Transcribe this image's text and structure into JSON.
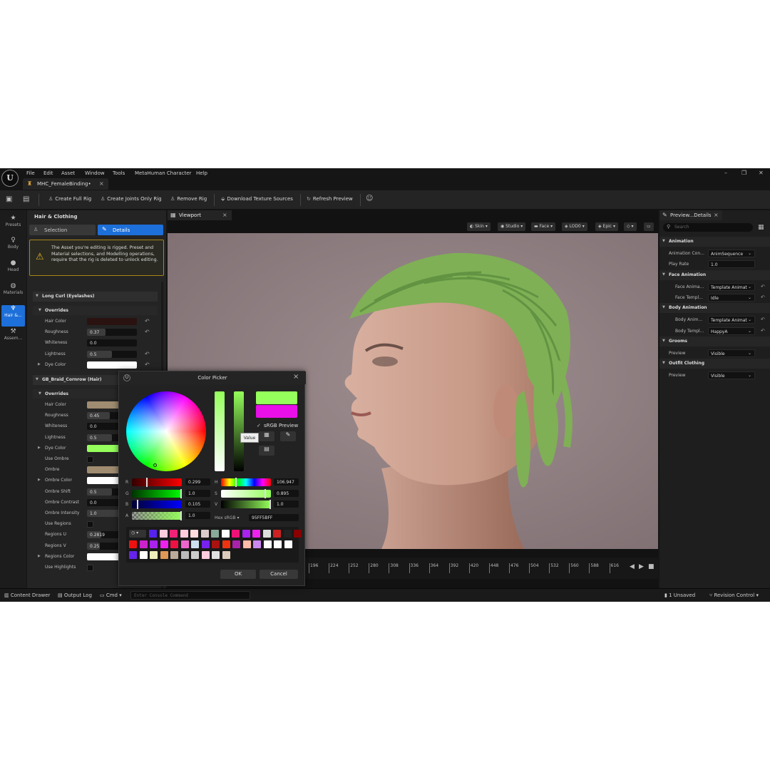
{
  "menubar": {
    "items": [
      "File",
      "Edit",
      "Asset",
      "Window",
      "Tools",
      "MetaHuman Character",
      "Help"
    ],
    "window_controls": [
      "–",
      "❐",
      "✕"
    ]
  },
  "doc_tab": {
    "label": "MHC_FemaleBinding•",
    "close": "×"
  },
  "toolbar": {
    "create_full_rig": "Create Full Rig",
    "create_joints_only_rig": "Create Joints Only Rig",
    "remove_rig": "Remove Rig",
    "download_texture_sources": "Download Texture Sources",
    "refresh_preview": "Refresh Preview"
  },
  "iconbar": {
    "items": [
      {
        "label": "Presets",
        "icon": "star-icon"
      },
      {
        "label": "Body",
        "icon": "body-icon"
      },
      {
        "label": "Head",
        "icon": "head-icon"
      },
      {
        "label": "Materials",
        "icon": "materials-icon"
      },
      {
        "label": "Hair &...",
        "icon": "hair-icon",
        "active": true
      },
      {
        "label": "Assem...",
        "icon": "hammer-icon"
      }
    ]
  },
  "left_panel": {
    "title": "Hair & Clothing",
    "tab_selection": "Selection",
    "tab_details": "Details",
    "warning": "The Asset you're editing is rigged. Preset and Material selections, and Modelling operations, require that the rig is deleted to unlock editing.",
    "section1": {
      "title": "Long Curl (Eyelashes)",
      "overrides": "Overrides",
      "rows": [
        {
          "label": "Hair Color",
          "kind": "swatch",
          "color": "#2a1210",
          "reset": true
        },
        {
          "label": "Roughness",
          "kind": "number",
          "value": "0.37",
          "fill": 0.37,
          "reset": true
        },
        {
          "label": "Whiteness",
          "kind": "number",
          "value": "0.0",
          "fill": 0.0,
          "reset": false
        },
        {
          "label": "Lightness",
          "kind": "number",
          "value": "0.5",
          "fill": 0.5,
          "reset": true
        },
        {
          "label": "Dye Color",
          "kind": "swatch",
          "color": "#ffffff",
          "reset": true,
          "expandable": true
        }
      ]
    },
    "section2": {
      "title": "GB_Braid_Cornrow (Hair)",
      "overrides": "Overrides",
      "rows": [
        {
          "label": "Hair Color",
          "kind": "swatch",
          "color": "#a08c70"
        },
        {
          "label": "Roughness",
          "kind": "number",
          "value": "0.45",
          "fill": 0.45
        },
        {
          "label": "Whiteness",
          "kind": "number",
          "value": "0.0",
          "fill": 0.0
        },
        {
          "label": "Lightness",
          "kind": "number",
          "value": "0.5",
          "fill": 0.5
        },
        {
          "label": "Dye Color",
          "kind": "swatch",
          "color": "#95ff5b",
          "expandable": true
        },
        {
          "label": "Use Ombre",
          "kind": "check"
        },
        {
          "label": "Ombre",
          "kind": "swatch",
          "color": "#a08c70"
        },
        {
          "label": "Ombre Color",
          "kind": "swatch",
          "color": "#ffffff",
          "expandable": true
        },
        {
          "label": "Ombre Shift",
          "kind": "number",
          "value": "0.5",
          "fill": 0.5
        },
        {
          "label": "Ombre Contrast",
          "kind": "number",
          "value": "0.0",
          "fill": 0.0
        },
        {
          "label": "Ombre Intensity",
          "kind": "number",
          "value": "1.0",
          "fill": 1.0
        },
        {
          "label": "Use Regions",
          "kind": "check"
        },
        {
          "label": "Regions U",
          "kind": "number",
          "value": "0.2819",
          "fill": 0.28
        },
        {
          "label": "Regions V",
          "kind": "number",
          "value": "0.25",
          "fill": 0.25
        },
        {
          "label": "Regions Color",
          "kind": "swatch",
          "color": "#ffffff",
          "expandable": true
        },
        {
          "label": "Use Highlights",
          "kind": "check"
        }
      ]
    }
  },
  "viewport": {
    "tab": "Viewport",
    "buttons": [
      "Skin",
      "Studio",
      "Face",
      "LOD0",
      "Epic"
    ],
    "timeline_ticks": [
      "196",
      "224",
      "252",
      "280",
      "308",
      "336",
      "364",
      "392",
      "420",
      "448",
      "476",
      "504",
      "532",
      "560",
      "588",
      "616"
    ]
  },
  "color_picker": {
    "title": "Color Picker",
    "new_color": "#95ff5b",
    "old_color": "#e80fe8",
    "srgb_preview": "sRGB Preview",
    "tooltip": "Value",
    "rgba": [
      {
        "label": "R",
        "value": "0.299",
        "marker": 0.299
      },
      {
        "label": "G",
        "value": "1.0",
        "marker": 1.0
      },
      {
        "label": "B",
        "value": "0.105",
        "marker": 0.105
      },
      {
        "label": "A",
        "value": "1.0",
        "marker": 1.0
      }
    ],
    "hsv": [
      {
        "label": "H",
        "value": "106.947",
        "marker": 0.297
      },
      {
        "label": "S",
        "value": "0.895",
        "marker": 0.895
      },
      {
        "label": "V",
        "value": "1.0",
        "marker": 1.0
      }
    ],
    "hex_label": "Hex sRGB",
    "hex_value": "95FF5BFF",
    "ok": "OK",
    "cancel": "Cancel",
    "swatches_row1": [
      "#5522ee",
      "#ffccdd",
      "#ee2277",
      "#ffccdd",
      "#ffdddd",
      "#ddcccc",
      "#88aa99",
      "#ffffff",
      "#ee1177",
      "#aa22ee",
      "#ee22ee",
      "#dddddd",
      "#cc2222",
      "#222222",
      "#880000"
    ],
    "swatches_row2": [
      "#ee1111",
      "#cc22cc",
      "#aa22ee",
      "#ee22ee",
      "#ee1144",
      "#ee66cc",
      "#cce0ee",
      "#7722ee",
      "#aa1111",
      "#ee3311",
      "#aa22aa",
      "#ffbbaa",
      "#cc88ee",
      "#ffffff",
      "#ffffff",
      "#ffffff"
    ],
    "swatches_row3": [
      "#6622ee",
      "#ffffff",
      "#eeeebb",
      "#dd9955",
      "#bbaa99",
      "#bbbbbb",
      "#cccccc",
      "#ffccdd",
      "#e0e0e0",
      "#ddccbb"
    ]
  },
  "right_panel": {
    "tab": "Preview...Details",
    "search_placeholder": "Search",
    "categories": [
      {
        "title": "Animation",
        "rows": [
          {
            "label": "Animation Con...",
            "value": "AnimSequence",
            "kind": "select"
          },
          {
            "label": "Play Rate",
            "value": "1.0",
            "kind": "number"
          }
        ]
      },
      {
        "title": "Face Animation",
        "rows": [
          {
            "label": "Face Anima...",
            "value": "Template Animat",
            "kind": "select",
            "reset": true
          },
          {
            "label": "Face Templ...",
            "value": "Idle",
            "kind": "select",
            "reset": true
          }
        ]
      },
      {
        "title": "Body Animation",
        "rows": [
          {
            "label": "Body Anim...",
            "value": "Template Animat",
            "kind": "select",
            "reset": true
          },
          {
            "label": "Body Templ...",
            "value": "HappyA",
            "kind": "select",
            "reset": true
          }
        ]
      },
      {
        "title": "Grooms",
        "rows": [
          {
            "label": "Preview",
            "value": "Visible",
            "kind": "select"
          }
        ]
      },
      {
        "title": "Outfit Clothing",
        "rows": [
          {
            "label": "Preview",
            "value": "Visible",
            "kind": "select"
          }
        ]
      }
    ]
  },
  "statusbar": {
    "content_drawer": "Content Drawer",
    "output_log": "Output Log",
    "cmd": "Cmd",
    "console_placeholder": "Enter Console Command",
    "unsaved": "1 Unsaved",
    "revision_control": "Revision Control"
  },
  "colors": {
    "accent": "#1d6fd9",
    "hair_dye": "#95ff5b"
  }
}
